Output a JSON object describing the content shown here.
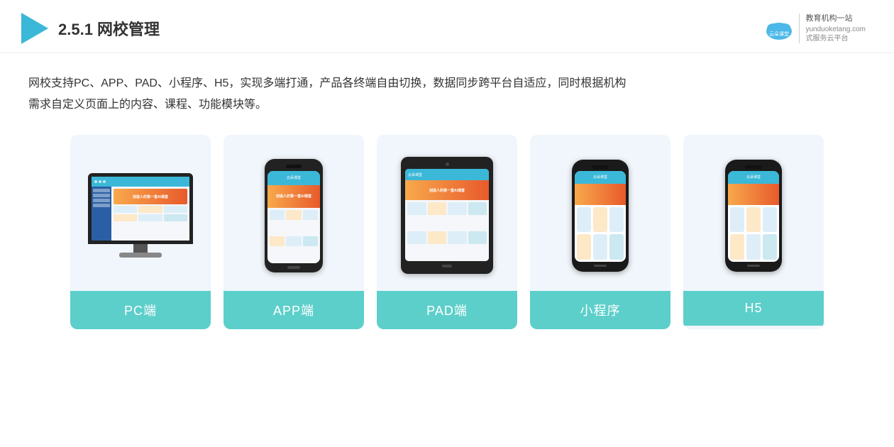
{
  "header": {
    "title_prefix": "2.5.1 ",
    "title_bold": "网校管理",
    "logo_site": "yunduoketang.com",
    "logo_tagline1": "教育机构一站",
    "logo_tagline2": "式服务云平台"
  },
  "description": {
    "line1": "网校支持PC、APP、PAD、小程序、H5，实现多端打通，产品各终端自由切换，数据同步跨平台自适应，同时根据机构",
    "line2": "需求自定义页面上的内容、课程、功能模块等。"
  },
  "cards": [
    {
      "id": "pc",
      "label": "PC端"
    },
    {
      "id": "app",
      "label": "APP端"
    },
    {
      "id": "pad",
      "label": "PAD端"
    },
    {
      "id": "miniprogram",
      "label": "小程序"
    },
    {
      "id": "h5",
      "label": "H5"
    }
  ]
}
